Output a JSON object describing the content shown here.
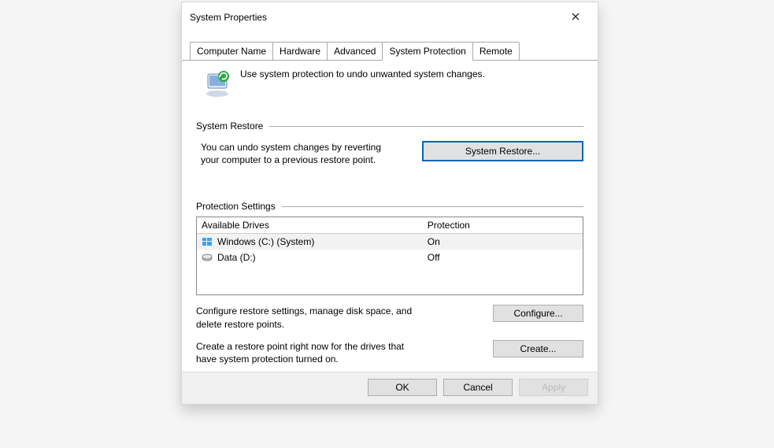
{
  "window": {
    "title": "System Properties"
  },
  "tabs": {
    "computer_name": "Computer Name",
    "hardware": "Hardware",
    "advanced": "Advanced",
    "system_protection": "System Protection",
    "remote": "Remote"
  },
  "intro_text": "Use system protection to undo unwanted system changes.",
  "section_restore": {
    "label": "System Restore",
    "description": "You can undo system changes by reverting your computer to a previous restore point.",
    "button": "System Restore..."
  },
  "section_protection": {
    "label": "Protection Settings",
    "columns": {
      "drives": "Available Drives",
      "protection": "Protection"
    },
    "rows": [
      {
        "name": "Windows (C:) (System)",
        "protection": "On",
        "icon": "windows"
      },
      {
        "name": "Data (D:)",
        "protection": "Off",
        "icon": "hdd"
      }
    ],
    "configure_text": "Configure restore settings, manage disk space, and delete restore points.",
    "configure_button": "Configure...",
    "create_text": "Create a restore point right now for the drives that have system protection turned on.",
    "create_button": "Create..."
  },
  "footer": {
    "ok": "OK",
    "cancel": "Cancel",
    "apply": "Apply"
  }
}
